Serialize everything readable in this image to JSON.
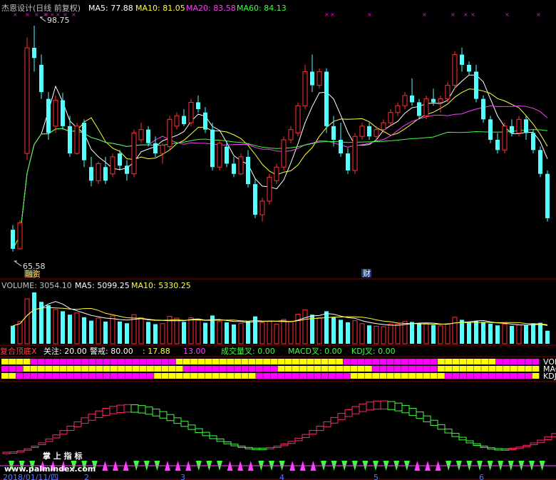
{
  "main_panel": {
    "title": "杰恩设计(日线 前复权)",
    "ma5": "MA5: 77.88",
    "ma10": "MA10: 81.05",
    "ma20": "MA20: 83.58",
    "ma60": "MA60: 84.13",
    "high_marker": "98.75",
    "low_marker": "65.58",
    "tag_left": "融资",
    "tag_right": "财"
  },
  "volume_panel": {
    "label": "VOLUME: 3054.10",
    "ma5": "MA5: 5099.25",
    "ma10": "MA10: 5330.25"
  },
  "indicator_panel": {
    "name": "复合顶底X",
    "focus": "关注: 20.00",
    "alert": "警戒: 80.00",
    "v1": ": 17.88",
    "v2": "13.00",
    "vol_cross": "成交量叉: 0.00",
    "macd_cross": "MACD叉: 0.00",
    "kdj_cross": "KDJ叉: 0.00",
    "row_labels": [
      "VOL",
      "MAC",
      "KDJ"
    ]
  },
  "footer": {
    "watermark_cn": "掌 上 指 标",
    "watermark_url": "www.palmindex.com",
    "date": "2018/01/11/四",
    "axis_marks": [
      "2",
      "3",
      "4",
      "5",
      "6"
    ]
  },
  "colors": {
    "up": "#ff3333",
    "down": "#54ffff",
    "ma5": "#ffffff",
    "ma10": "#ffff40",
    "ma20": "#ff40ff",
    "ma60": "#40ff40",
    "grid": "#8b0000",
    "yellow_block": "#ffff00",
    "magenta_block": "#ff00ff"
  },
  "chart_data": {
    "type": "candlestick",
    "price_range": [
      65.58,
      98.75
    ],
    "candles": [
      [
        68.8,
        69.5,
        65.6,
        66.0
      ],
      [
        66.0,
        70.2,
        65.9,
        69.8
      ],
      [
        80.0,
        97.0,
        79.0,
        95.5
      ],
      [
        95.5,
        98.75,
        92.0,
        94.0
      ],
      [
        93.0,
        94.5,
        88.0,
        89.0
      ],
      [
        88.0,
        89.0,
        82.0,
        83.0
      ],
      [
        84.0,
        88.5,
        83.0,
        87.8
      ],
      [
        87.8,
        88.9,
        83.5,
        84.0
      ],
      [
        84.0,
        85.5,
        79.5,
        80.0
      ],
      [
        80.0,
        84.5,
        79.8,
        84.0
      ],
      [
        84.5,
        85.0,
        78.0,
        79.0
      ],
      [
        78.0,
        79.5,
        75.2,
        76.0
      ],
      [
        76.0,
        78.8,
        75.5,
        78.5
      ],
      [
        78.0,
        79.5,
        75.5,
        76.0
      ],
      [
        77.0,
        80.0,
        76.5,
        79.5
      ],
      [
        80.0,
        80.5,
        77.5,
        78.2
      ],
      [
        78.2,
        79.0,
        76.0,
        77.0
      ],
      [
        77.0,
        83.5,
        76.5,
        83.0
      ],
      [
        82.0,
        84.5,
        81.5,
        83.5
      ],
      [
        83.5,
        84.0,
        81.0,
        81.5
      ],
      [
        81.5,
        82.5,
        79.5,
        80.0
      ],
      [
        80.0,
        81.5,
        78.5,
        81.2
      ],
      [
        81.0,
        85.5,
        80.5,
        85.0
      ],
      [
        84.0,
        86.0,
        83.5,
        85.5
      ],
      [
        85.5,
        86.5,
        84.0,
        84.3
      ],
      [
        84.5,
        88.0,
        84.0,
        87.5
      ],
      [
        87.5,
        88.5,
        86.0,
        86.5
      ],
      [
        86.0,
        86.8,
        83.0,
        83.5
      ],
      [
        83.5,
        84.5,
        77.5,
        78.0
      ],
      [
        78.0,
        82.0,
        77.5,
        81.5
      ],
      [
        81.0,
        81.8,
        78.0,
        78.5
      ],
      [
        78.5,
        79.5,
        76.5,
        77.0
      ],
      [
        77.0,
        80.0,
        76.8,
        79.5
      ],
      [
        79.5,
        80.5,
        75.0,
        75.5
      ],
      [
        75.5,
        76.2,
        70.5,
        71.0
      ],
      [
        71.0,
        73.5,
        70.0,
        73.0
      ],
      [
        73.0,
        77.0,
        72.5,
        76.5
      ],
      [
        76.0,
        78.5,
        75.5,
        78.0
      ],
      [
        78.0,
        82.5,
        77.5,
        82.0
      ],
      [
        82.0,
        84.0,
        81.5,
        83.5
      ],
      [
        83.0,
        87.5,
        82.5,
        87.0
      ],
      [
        87.0,
        93.0,
        86.5,
        92.0
      ],
      [
        92.0,
        94.5,
        89.0,
        90.0
      ],
      [
        90.0,
        92.5,
        89.5,
        92.0
      ],
      [
        92.0,
        92.5,
        83.0,
        84.0
      ],
      [
        84.0,
        85.5,
        81.0,
        82.0
      ],
      [
        82.0,
        84.5,
        79.5,
        80.0
      ],
      [
        80.0,
        80.8,
        77.0,
        77.5
      ],
      [
        77.5,
        83.0,
        77.0,
        82.5
      ],
      [
        82.5,
        84.5,
        82.0,
        84.0
      ],
      [
        84.0,
        84.5,
        82.0,
        82.5
      ],
      [
        82.5,
        84.0,
        82.0,
        83.5
      ],
      [
        83.5,
        85.0,
        83.0,
        84.5
      ],
      [
        84.5,
        86.5,
        84.0,
        86.0
      ],
      [
        86.0,
        87.5,
        85.5,
        87.0
      ],
      [
        87.0,
        89.0,
        86.5,
        88.5
      ],
      [
        88.5,
        91.0,
        87.0,
        87.5
      ],
      [
        87.5,
        88.0,
        85.0,
        85.5
      ],
      [
        85.5,
        88.5,
        85.0,
        88.0
      ],
      [
        88.0,
        89.5,
        87.0,
        87.5
      ],
      [
        87.5,
        88.5,
        86.0,
        88.0
      ],
      [
        88.0,
        90.5,
        87.5,
        90.0
      ],
      [
        90.0,
        95.0,
        89.5,
        94.5
      ],
      [
        94.5,
        95.5,
        92.0,
        93.0
      ],
      [
        93.0,
        93.5,
        91.5,
        92.0
      ],
      [
        92.0,
        93.0,
        87.5,
        88.0
      ],
      [
        88.0,
        88.5,
        84.5,
        85.0
      ],
      [
        85.0,
        85.5,
        81.5,
        82.0
      ],
      [
        82.0,
        83.0,
        80.0,
        80.5
      ],
      [
        80.5,
        84.5,
        80.0,
        84.0
      ],
      [
        84.0,
        85.0,
        82.5,
        83.0
      ],
      [
        83.0,
        85.5,
        82.5,
        85.0
      ],
      [
        85.0,
        85.5,
        82.0,
        83.0
      ],
      [
        83.0,
        83.5,
        80.0,
        80.5
      ],
      [
        80.5,
        81.0,
        76.5,
        77.0
      ],
      [
        77.0,
        77.5,
        70.0,
        70.5
      ]
    ],
    "volume": [
      [
        4200,
        0
      ],
      [
        5200,
        1
      ],
      [
        10500,
        1
      ],
      [
        12000,
        0
      ],
      [
        9800,
        0
      ],
      [
        9000,
        0
      ],
      [
        8000,
        1
      ],
      [
        7600,
        0
      ],
      [
        6800,
        0
      ],
      [
        7200,
        1
      ],
      [
        6200,
        0
      ],
      [
        5400,
        0
      ],
      [
        6000,
        1
      ],
      [
        5200,
        0
      ],
      [
        6500,
        1
      ],
      [
        5200,
        0
      ],
      [
        4800,
        0
      ],
      [
        6800,
        1
      ],
      [
        6100,
        1
      ],
      [
        5100,
        0
      ],
      [
        4600,
        0
      ],
      [
        4700,
        1
      ],
      [
        6400,
        1
      ],
      [
        6000,
        1
      ],
      [
        5100,
        0
      ],
      [
        6100,
        1
      ],
      [
        5500,
        1
      ],
      [
        4900,
        0
      ],
      [
        6600,
        0
      ],
      [
        5200,
        1
      ],
      [
        5000,
        0
      ],
      [
        4500,
        0
      ],
      [
        4800,
        1
      ],
      [
        5300,
        0
      ],
      [
        6400,
        0
      ],
      [
        4900,
        1
      ],
      [
        5200,
        1
      ],
      [
        4600,
        1
      ],
      [
        5700,
        1
      ],
      [
        5300,
        1
      ],
      [
        6900,
        1
      ],
      [
        7900,
        1
      ],
      [
        6800,
        0
      ],
      [
        6100,
        1
      ],
      [
        7600,
        0
      ],
      [
        6200,
        0
      ],
      [
        5600,
        0
      ],
      [
        5000,
        0
      ],
      [
        5400,
        1
      ],
      [
        4700,
        1
      ],
      [
        4300,
        0
      ],
      [
        4100,
        1
      ],
      [
        4000,
        1
      ],
      [
        4600,
        1
      ],
      [
        4600,
        1
      ],
      [
        5200,
        1
      ],
      [
        5100,
        0
      ],
      [
        4700,
        0
      ],
      [
        4800,
        1
      ],
      [
        4400,
        0
      ],
      [
        4200,
        1
      ],
      [
        4700,
        1
      ],
      [
        6200,
        1
      ],
      [
        5600,
        0
      ],
      [
        4900,
        0
      ],
      [
        5300,
        0
      ],
      [
        5100,
        0
      ],
      [
        4700,
        0
      ],
      [
        4300,
        0
      ],
      [
        4600,
        1
      ],
      [
        4200,
        0
      ],
      [
        4400,
        1
      ],
      [
        4300,
        0
      ],
      [
        4800,
        0
      ],
      [
        4900,
        0
      ],
      [
        3054,
        0
      ]
    ]
  }
}
